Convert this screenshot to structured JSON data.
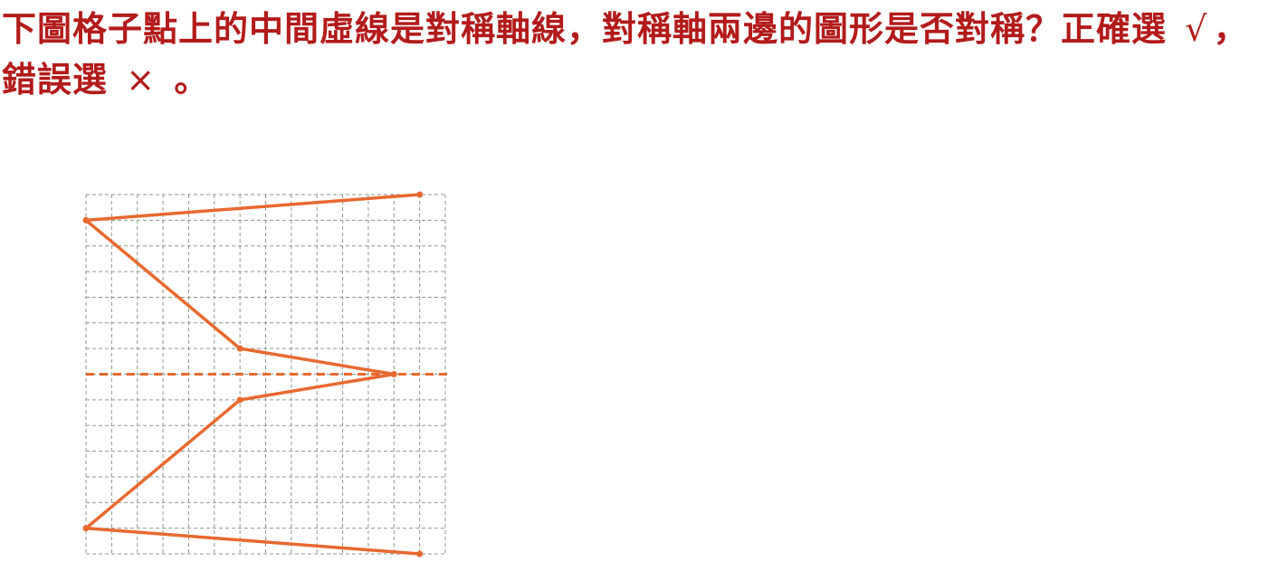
{
  "question": {
    "line1": "下圖格子點上的中間虛線是對稱軸線，對稱軸兩邊的圖形是否對",
    "line2_start": "稱？正確選",
    "check_mark": "√",
    "line2_mid": "，錯誤選",
    "cross_mark": "×",
    "line2_end": "。"
  },
  "figure": {
    "grid_columns": 14,
    "grid_rows": 14,
    "grid_color": "#8a9a8a",
    "shape_color": "#e8692f",
    "axis_row": 7,
    "polyline": [
      [
        13,
        0
      ],
      [
        0,
        1
      ],
      [
        6,
        6
      ],
      [
        12,
        7
      ],
      [
        6,
        8
      ],
      [
        0,
        13
      ],
      [
        13,
        14
      ]
    ]
  }
}
